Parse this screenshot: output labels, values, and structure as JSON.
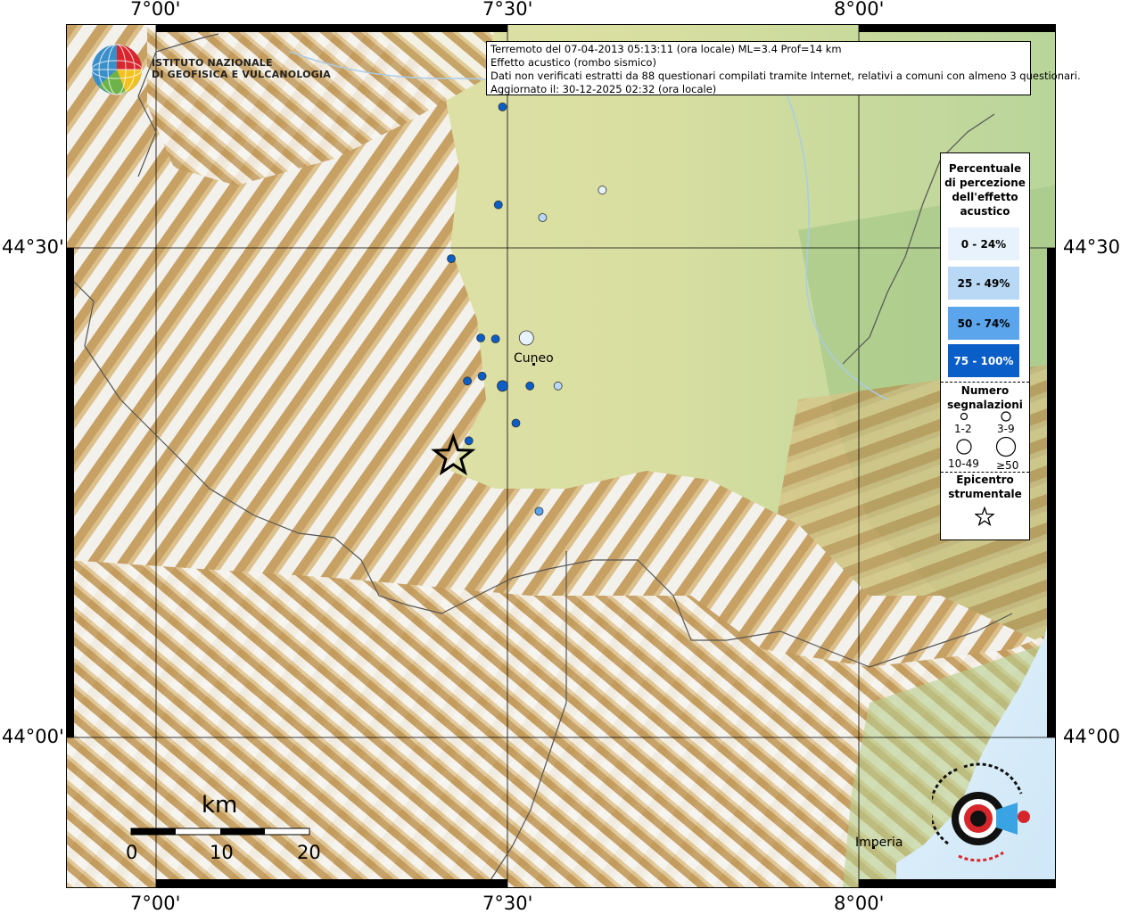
{
  "header": {
    "line1": "Terremoto del 07-04-2013 05:13:11 (ora locale) ML=3.4 Prof=14 km",
    "line2": "Effetto acustico (rombo sismico)",
    "line3": "Dati non verificati estratti da 88 questionari compilati tramite Internet, relativi a comuni con almeno 3 questionari.",
    "line4": "Aggiornato il: 30-12-2025 02:32 (ora locale)"
  },
  "logo": {
    "line1": "ISTITUTO NAZIONALE",
    "line2": "DI GEOFISICA E VULCANOLOGIA"
  },
  "axes": {
    "top": [
      "7°00'",
      "7°30'",
      "8°00'"
    ],
    "bottom": [
      "7°00'",
      "7°30'",
      "8°00'"
    ],
    "left": [
      "44°30'",
      "44°00'"
    ],
    "right": [
      "44°30'",
      "44°00'"
    ]
  },
  "legend": {
    "title": [
      "Percentuale",
      "di percezione",
      "dell'effetto",
      "acustico"
    ],
    "classes": [
      {
        "label": "0 - 24%",
        "color": "#e8f2fc"
      },
      {
        "label": "25 - 49%",
        "color": "#b8d8f5"
      },
      {
        "label": "50 - 74%",
        "color": "#5aa5ec"
      },
      {
        "label": "75 - 100%",
        "color": "#0a5ec8"
      }
    ],
    "count_title": [
      "Numero",
      "segnalazioni"
    ],
    "count_classes": [
      "1-2",
      "3-9",
      "10-49",
      "≥50"
    ],
    "epicenter_title": [
      "Epicentro",
      "strumentale"
    ]
  },
  "cities": [
    {
      "name": "Cuneo"
    },
    {
      "name": "Imperia"
    }
  ],
  "scale": {
    "title": "km",
    "labels": [
      "0",
      "10",
      "20"
    ]
  },
  "observations": [
    {
      "lon": 7.493,
      "lat": 44.644,
      "pct_class": 3,
      "count_class": 0
    },
    {
      "lon": 7.635,
      "lat": 44.559,
      "pct_class": 0,
      "count_class": 0
    },
    {
      "lon": 7.487,
      "lat": 44.544,
      "pct_class": 3,
      "count_class": 0
    },
    {
      "lon": 7.55,
      "lat": 44.531,
      "pct_class": 1,
      "count_class": 0
    },
    {
      "lon": 7.42,
      "lat": 44.489,
      "pct_class": 3,
      "count_class": 0
    },
    {
      "lon": 7.462,
      "lat": 44.408,
      "pct_class": 3,
      "count_class": 0
    },
    {
      "lon": 7.483,
      "lat": 44.407,
      "pct_class": 3,
      "count_class": 0
    },
    {
      "lon": 7.527,
      "lat": 44.408,
      "pct_class": 0,
      "count_class": 2
    },
    {
      "lon": 7.443,
      "lat": 44.364,
      "pct_class": 3,
      "count_class": 0
    },
    {
      "lon": 7.464,
      "lat": 44.369,
      "pct_class": 3,
      "count_class": 0
    },
    {
      "lon": 7.493,
      "lat": 44.359,
      "pct_class": 3,
      "count_class": 1
    },
    {
      "lon": 7.532,
      "lat": 44.359,
      "pct_class": 3,
      "count_class": 0
    },
    {
      "lon": 7.572,
      "lat": 44.359,
      "pct_class": 1,
      "count_class": 0
    },
    {
      "lon": 7.512,
      "lat": 44.321,
      "pct_class": 3,
      "count_class": 0
    },
    {
      "lon": 7.445,
      "lat": 44.303,
      "pct_class": 3,
      "count_class": 0
    },
    {
      "lon": 7.545,
      "lat": 44.231,
      "pct_class": 2,
      "count_class": 0
    }
  ],
  "epicenter": {
    "lon": 7.423,
    "lat": 44.287
  },
  "colors": {
    "plain": "#e8e2a8",
    "hills": "#c9a060",
    "mountain_high": "#f4f4f4",
    "valley_green": "#9fc486",
    "sea": "#dceefa",
    "border_line": "#555555"
  }
}
